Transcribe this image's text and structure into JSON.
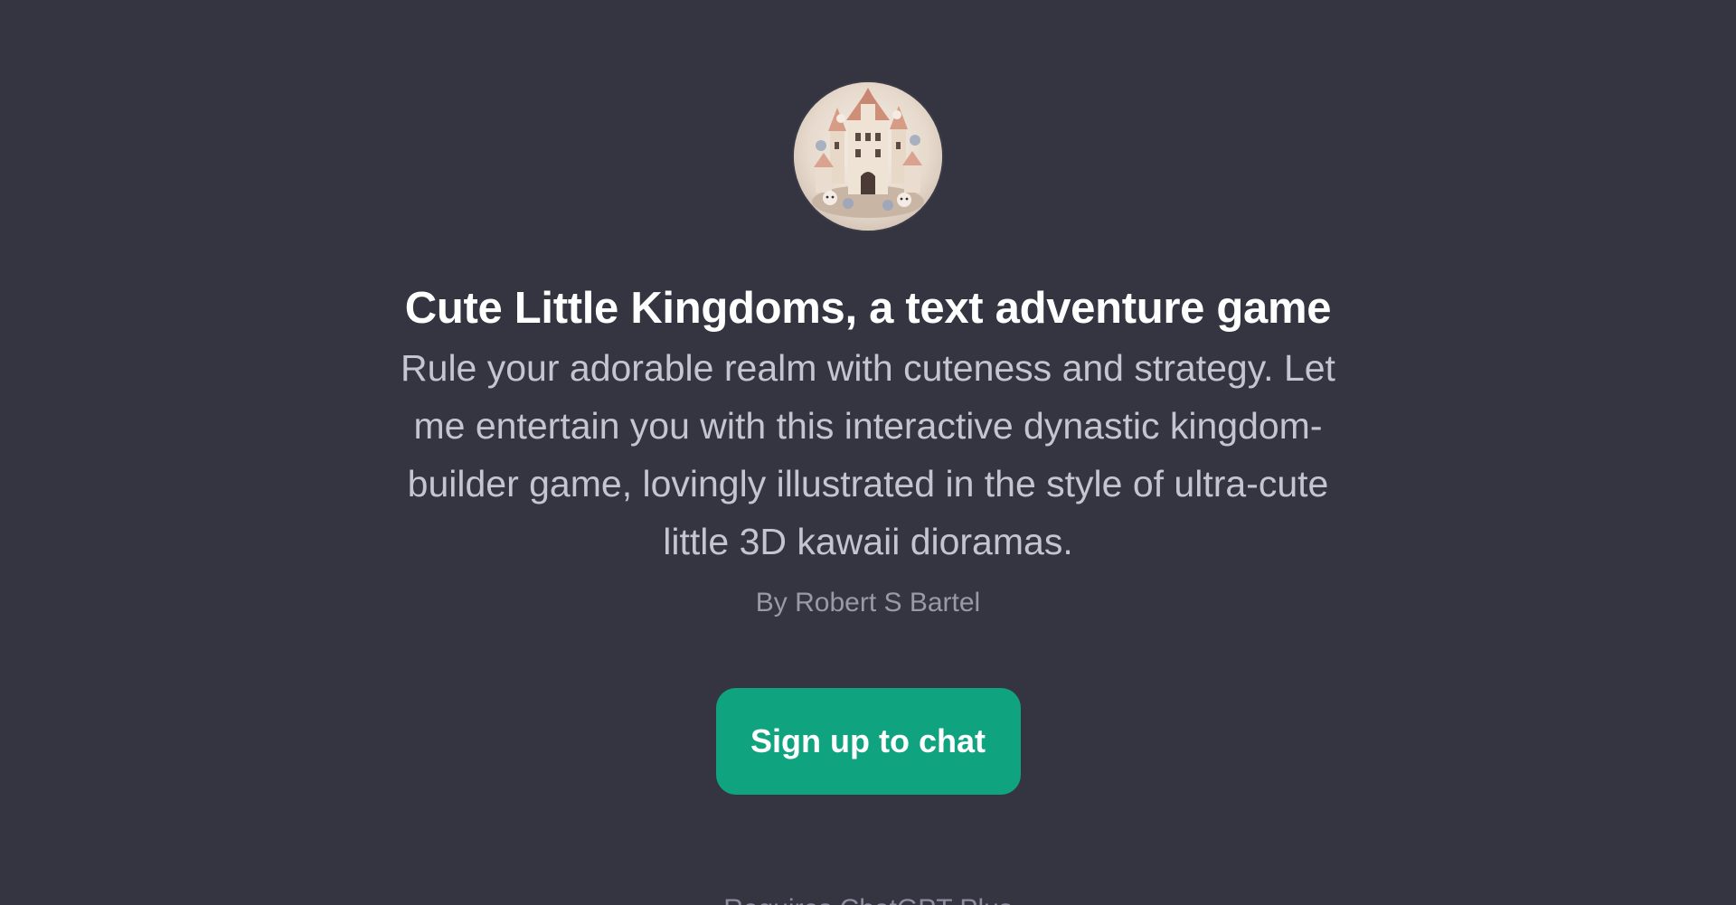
{
  "gpt": {
    "avatar_icon": "castle-diorama-image",
    "title": "Cute Little Kingdoms, a text adventure game",
    "description": "Rule your adorable realm with cuteness and strategy. Let me entertain you with this interactive dynastic kingdom-builder game, lovingly illustrated in the style of ultra-cute little 3D kawaii dioramas.",
    "author": "By Robert S Bartel"
  },
  "actions": {
    "signup_label": "Sign up to chat"
  },
  "footer": {
    "text": "Requires ChatGPT Plus"
  },
  "colors": {
    "background": "#343541",
    "accent": "#10a37f",
    "title": "#ffffff",
    "description": "#c5c5d2",
    "muted": "#9a9aa6"
  }
}
